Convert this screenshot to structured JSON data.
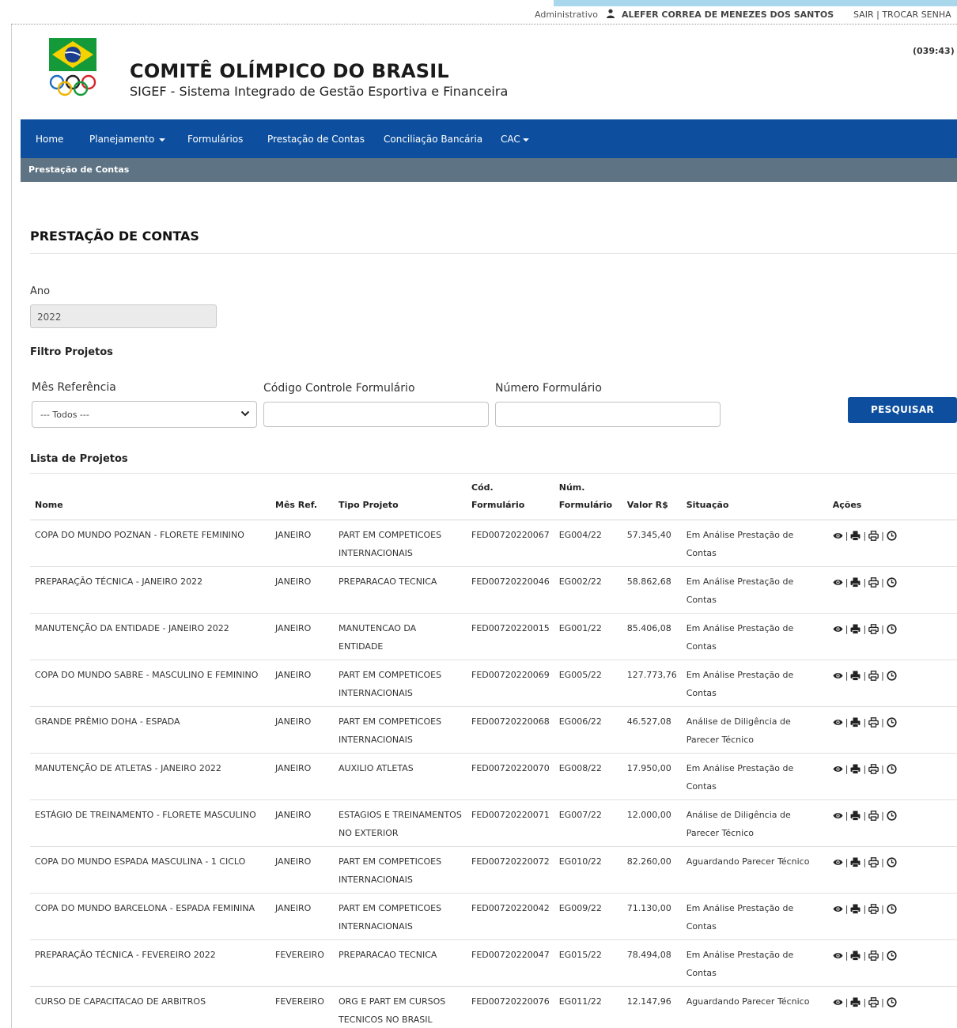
{
  "top": {
    "admin": "Administrativo",
    "user": "ALEFER CORREA DE MENEZES DOS SANTOS",
    "sair": "SAIR",
    "divider": "|",
    "trocar": "TROCAR SENHA"
  },
  "header": {
    "title": "COMITÊ OLÍMPICO DO BRASIL",
    "subtitle": "SIGEF - Sistema Integrado de Gestão Esportiva e Financeira",
    "timer": "(039:43)"
  },
  "nav": {
    "home": "Home",
    "planejamento": "Planejamento",
    "formularios": "Formulários",
    "prestacao": "Prestação de Contas",
    "conciliacao": "Conciliação Bancária",
    "cac": "CAC"
  },
  "breadcrumb": "Prestação de Contas",
  "page": {
    "title": "PRESTAÇÃO DE CONTAS",
    "ano_label": "Ano",
    "ano_value": "2022",
    "filtro_label": "Filtro Projetos",
    "mes_label": "Mês Referência",
    "mes_value": "--- Todos ---",
    "codigo_label": "Código Controle Formulário",
    "numero_label": "Número Formulário",
    "search_button": "PESQUISAR",
    "lista_label": "Lista de Projetos"
  },
  "colors": {
    "nav_blue": "#0d4f9e",
    "subbar_gray": "#5e7383"
  },
  "table": {
    "headers": {
      "nome": "Nome",
      "mes": "Mês Ref.",
      "tipo": "Tipo Projeto",
      "cod": "Cód. Formulário",
      "num_1": "Núm.",
      "num_2": "Formulário",
      "valor": "Valor R$",
      "situacao": "Situação",
      "acoes": "Ações"
    },
    "action_icons": [
      "eye-icon",
      "print-icon",
      "printer-icon",
      "clock-icon"
    ],
    "rows": [
      {
        "nome": "COPA DO MUNDO POZNAN - FLORETE FEMININO",
        "mes": "JANEIRO",
        "tipo": "PART EM COMPETICOES INTERNACIONAIS",
        "cod": "FED00720220067",
        "num": "EG004/22",
        "valor": "57.345,40",
        "situacao": "Em Análise Prestação de Contas"
      },
      {
        "nome": "PREPARAÇÃO TÉCNICA - JANEIRO 2022",
        "mes": "JANEIRO",
        "tipo": "PREPARACAO TECNICA",
        "cod": "FED00720220046",
        "num": "EG002/22",
        "valor": "58.862,68",
        "situacao": "Em Análise Prestação de Contas"
      },
      {
        "nome": "MANUTENÇÃO DA ENTIDADE - JANEIRO 2022",
        "mes": "JANEIRO",
        "tipo": "MANUTENCAO DA ENTIDADE",
        "cod": "FED00720220015",
        "num": "EG001/22",
        "valor": "85.406,08",
        "situacao": "Em Análise Prestação de Contas"
      },
      {
        "nome": "COPA DO MUNDO SABRE - MASCULINO E FEMININO",
        "mes": "JANEIRO",
        "tipo": "PART EM COMPETICOES INTERNACIONAIS",
        "cod": "FED00720220069",
        "num": "EG005/22",
        "valor": "127.773,76",
        "situacao": "Em Análise Prestação de Contas"
      },
      {
        "nome": "GRANDE PRÊMIO DOHA - ESPADA",
        "mes": "JANEIRO",
        "tipo": "PART EM COMPETICOES INTERNACIONAIS",
        "cod": "FED00720220068",
        "num": "EG006/22",
        "valor": "46.527,08",
        "situacao": "Análise de Diligência de Parecer Técnico"
      },
      {
        "nome": "MANUTENÇÃO DE ATLETAS - JANEIRO 2022",
        "mes": "JANEIRO",
        "tipo": "AUXILIO ATLETAS",
        "cod": "FED00720220070",
        "num": "EG008/22",
        "valor": "17.950,00",
        "situacao": "Em Análise Prestação de Contas"
      },
      {
        "nome": "ESTÁGIO DE TREINAMENTO - FLORETE MASCULINO",
        "mes": "JANEIRO",
        "tipo": "ESTAGIOS E TREINAMENTOS NO EXTERIOR",
        "cod": "FED00720220071",
        "num": "EG007/22",
        "valor": "12.000,00",
        "situacao": "Análise de Diligência de Parecer Técnico"
      },
      {
        "nome": "COPA DO MUNDO ESPADA MASCULINA - 1 CICLO",
        "mes": "JANEIRO",
        "tipo": "PART EM COMPETICOES INTERNACIONAIS",
        "cod": "FED00720220072",
        "num": "EG010/22",
        "valor": "82.260,00",
        "situacao": "Aguardando Parecer Técnico"
      },
      {
        "nome": "COPA DO MUNDO BARCELONA - ESPADA FEMININA",
        "mes": "JANEIRO",
        "tipo": "PART EM COMPETICOES INTERNACIONAIS",
        "cod": "FED00720220042",
        "num": "EG009/22",
        "valor": "71.130,00",
        "situacao": "Em Análise Prestação de Contas"
      },
      {
        "nome": "PREPARAÇÃO TÉCNICA - FEVEREIRO 2022",
        "mes": "FEVEREIRO",
        "tipo": "PREPARACAO TECNICA",
        "cod": "FED00720220047",
        "num": "EG015/22",
        "valor": "78.494,08",
        "situacao": "Em Análise Prestação de Contas"
      },
      {
        "nome": "CURSO DE CAPACITACAO DE ARBITROS",
        "mes": "FEVEREIRO",
        "tipo": "ORG E PART EM CURSOS TECNICOS NO BRASIL",
        "cod": "FED00720220076",
        "num": "EG011/22",
        "valor": "12.147,96",
        "situacao": "Aguardando Parecer Técnico"
      }
    ]
  }
}
